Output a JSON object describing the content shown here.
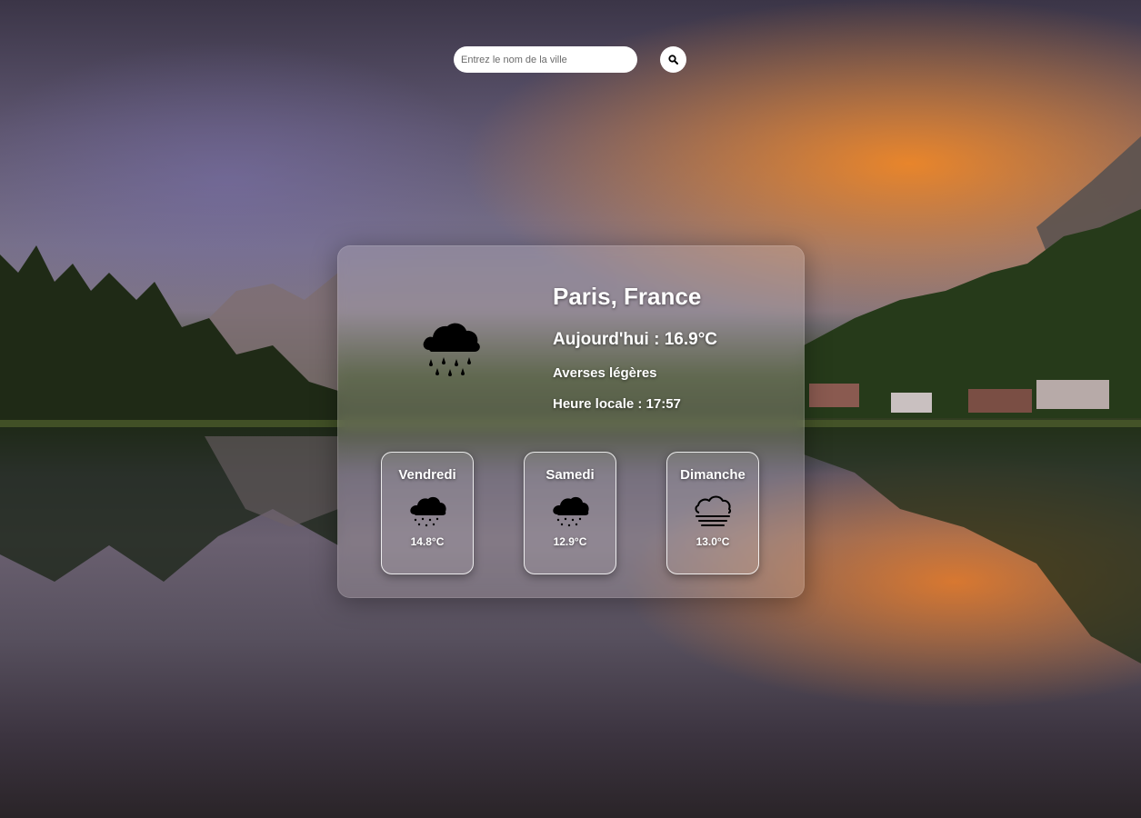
{
  "search": {
    "placeholder": "Entrez le nom de la ville",
    "button_icon": "search-icon"
  },
  "current": {
    "location": "Paris, France",
    "today_label": "Aujourd'hui : 16.9°C",
    "description": "Averses légères",
    "local_time": "Heure locale : 17:57",
    "icon": "rain-cloud-icon"
  },
  "forecast": [
    {
      "day": "Vendredi",
      "temp": "14.8°C",
      "icon": "light-rain-cloud-icon"
    },
    {
      "day": "Samedi",
      "temp": "12.9°C",
      "icon": "light-rain-cloud-icon"
    },
    {
      "day": "Dimanche",
      "temp": "13.0°C",
      "icon": "fog-cloud-icon"
    }
  ],
  "colors": {
    "text": "#ffffff",
    "card_border": "#ffffff",
    "icon": "#000000",
    "search_bg": "#ffffff"
  }
}
